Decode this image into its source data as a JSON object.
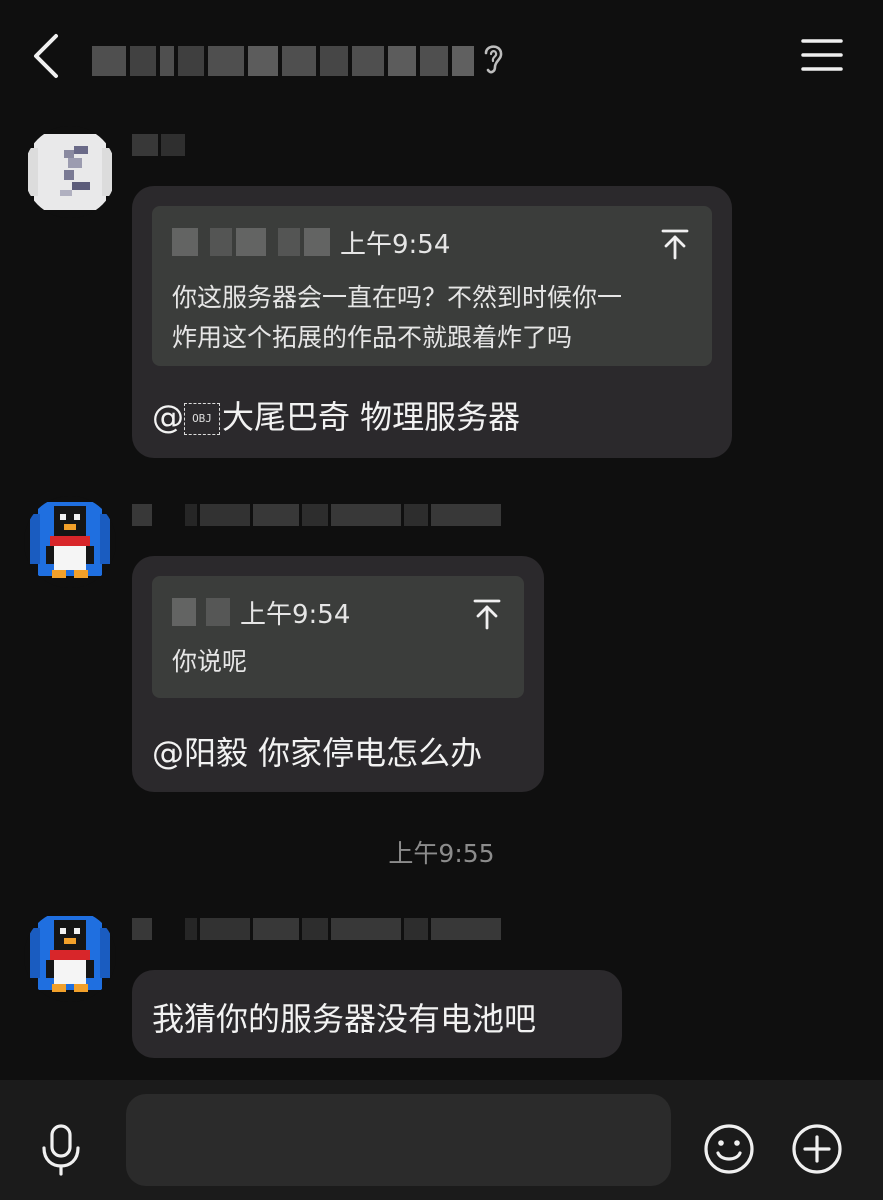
{
  "header": {
    "back_icon": "chevron-left-icon",
    "title_redacted": true,
    "ear_icon": "ear-icon",
    "menu_icon": "hamburger-menu-icon"
  },
  "messages": [
    {
      "sender_redacted": true,
      "quote": {
        "sender_redacted": true,
        "time": "上午9:54",
        "lines": [
          "你这服务器会一直在吗？不然到时候你一",
          "炸用这个拓展的作品不就跟着炸了吗"
        ]
      },
      "text_prefix": "@",
      "placeholder_glyph": "OBJ",
      "text": "大尾巴奇 物理服务器"
    },
    {
      "sender_redacted": true,
      "quote": {
        "sender_redacted": true,
        "time": "上午9:54",
        "lines": [
          "你说呢"
        ]
      },
      "text": "@阳毅 你家停电怎么办"
    },
    {
      "sender_redacted": true,
      "text": "我猜你的服务器没有电池吧"
    }
  ],
  "time_divider": "上午9:55",
  "composer": {
    "mic_icon": "microphone-icon",
    "input_value": "",
    "emoji_icon": "smiley-icon",
    "plus_icon": "plus-circle-icon"
  },
  "colors": {
    "background": "#0f0f0f",
    "bubble": "#2b292c",
    "quote": "#3b3d3b",
    "bottom_bar": "#1b1b1b",
    "avatar_blue": "#1f6fe0"
  }
}
